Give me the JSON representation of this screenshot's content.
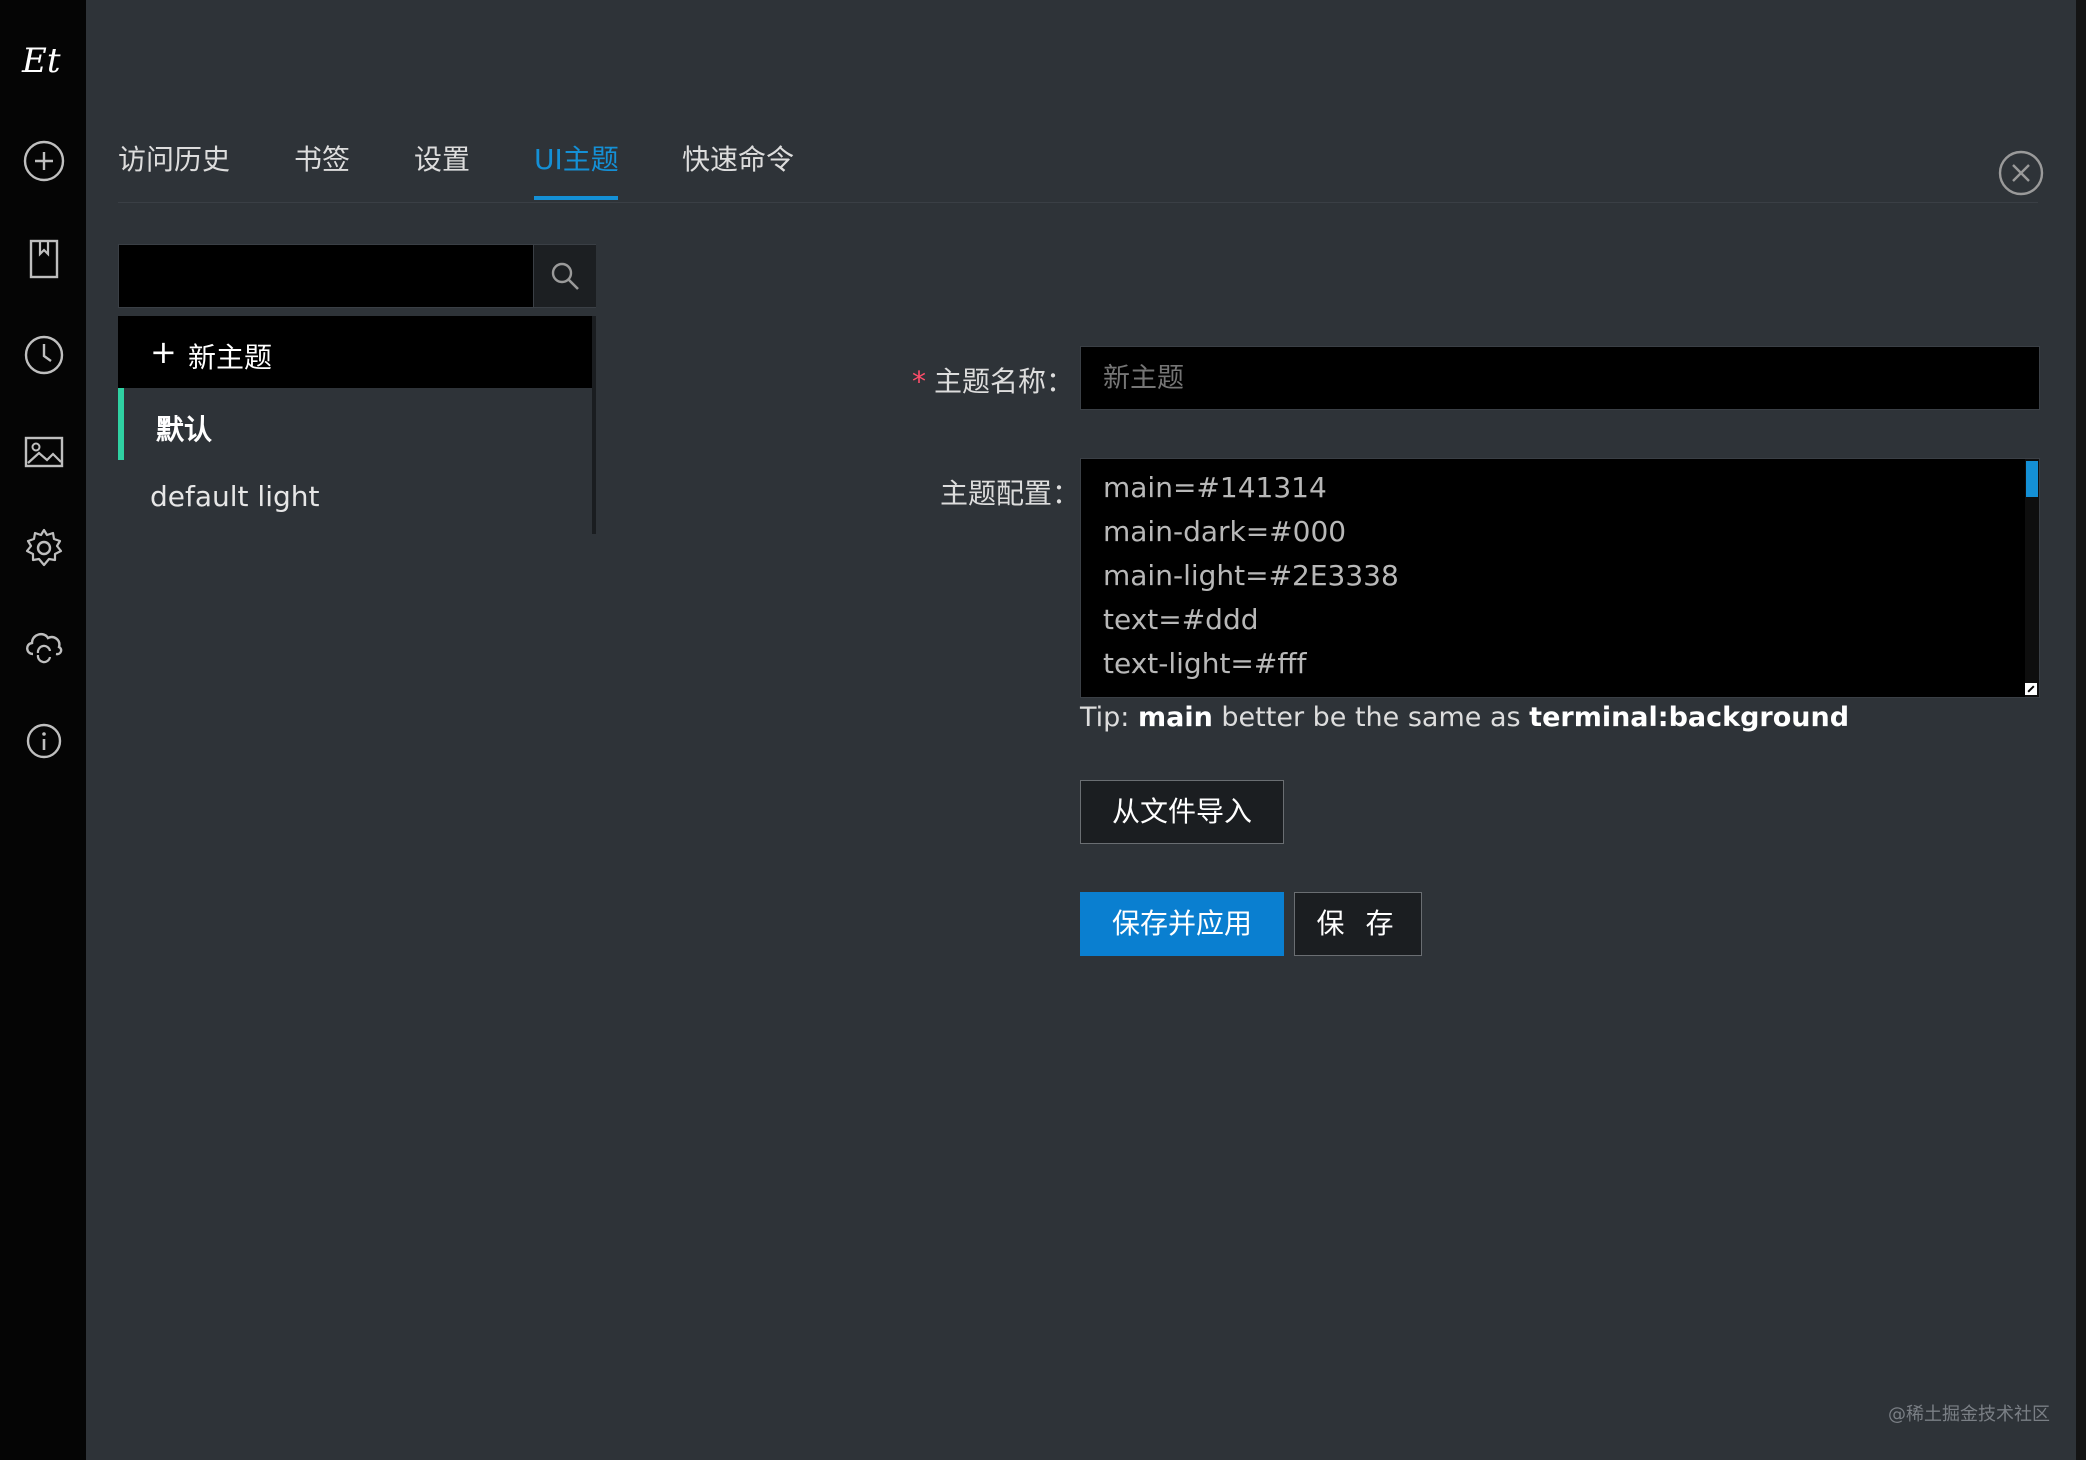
{
  "app": {
    "logo_text": "Et"
  },
  "rail": {
    "icons": [
      "add-circle-icon",
      "bookmark-icon",
      "clock-icon",
      "image-icon",
      "gear-icon",
      "cloud-sync-icon",
      "info-icon"
    ]
  },
  "tabs": [
    {
      "label": "访问历史",
      "active": false
    },
    {
      "label": "书签",
      "active": false
    },
    {
      "label": "设置",
      "active": false
    },
    {
      "label": "UI主题",
      "active": true
    },
    {
      "label": "快速命令",
      "active": false
    }
  ],
  "search": {
    "placeholder": "",
    "value": ""
  },
  "theme_list": {
    "new_item": {
      "icon": "+",
      "label": "新主题"
    },
    "items": [
      {
        "label": "默认",
        "active": true
      },
      {
        "label": "default light",
        "active": false
      }
    ]
  },
  "form": {
    "name_label": "主题名称：",
    "name_required_mark": "*",
    "name_placeholder": "新主题",
    "config_label": "主题配置：",
    "config_lines": [
      "main=#141314",
      "main-dark=#000",
      "main-light=#2E3338",
      "text=#ddd",
      "text-light=#fff"
    ],
    "tip": {
      "prefix": "Tip: ",
      "key1": "main",
      "middle": " better be the same as ",
      "key2": "terminal:background"
    },
    "import_button": "从文件导入",
    "save_apply_button": "保存并应用",
    "save_button": "保 存"
  },
  "watermark": "@稀土掘金技术社区",
  "colors": {
    "accent": "#1490d6",
    "active_marker": "#2fd1a2",
    "background": "#2e3338",
    "rail": "#050505",
    "required": "#ff4d6a"
  }
}
